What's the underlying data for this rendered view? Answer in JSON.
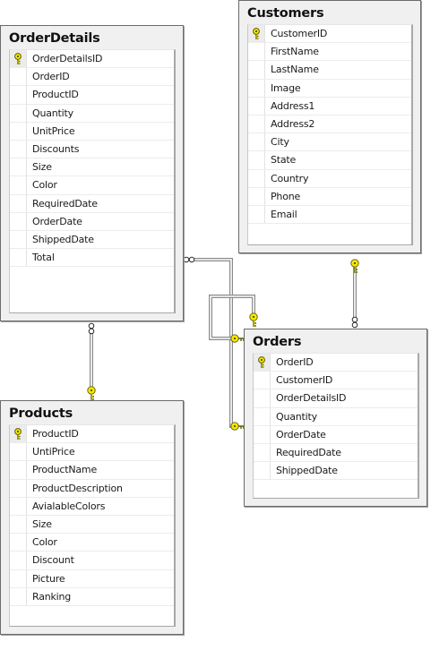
{
  "diagram": {
    "tables": [
      {
        "name": "OrderDetails",
        "columns": [
          {
            "name": "OrderDetailsID",
            "primary_key": true
          },
          {
            "name": "OrderID",
            "primary_key": false
          },
          {
            "name": "ProductID",
            "primary_key": false
          },
          {
            "name": "Quantity",
            "primary_key": false
          },
          {
            "name": "UnitPrice",
            "primary_key": false
          },
          {
            "name": "Discounts",
            "primary_key": false
          },
          {
            "name": "Size",
            "primary_key": false
          },
          {
            "name": "Color",
            "primary_key": false
          },
          {
            "name": "RequiredDate",
            "primary_key": false
          },
          {
            "name": "OrderDate",
            "primary_key": false
          },
          {
            "name": "ShippedDate",
            "primary_key": false
          },
          {
            "name": "Total",
            "primary_key": false
          }
        ]
      },
      {
        "name": "Customers",
        "columns": [
          {
            "name": "CustomerID",
            "primary_key": true
          },
          {
            "name": "FirstName",
            "primary_key": false
          },
          {
            "name": "LastName",
            "primary_key": false
          },
          {
            "name": "Image",
            "primary_key": false
          },
          {
            "name": "Address1",
            "primary_key": false
          },
          {
            "name": "Address2",
            "primary_key": false
          },
          {
            "name": "City",
            "primary_key": false
          },
          {
            "name": "State",
            "primary_key": false
          },
          {
            "name": "Country",
            "primary_key": false
          },
          {
            "name": "Phone",
            "primary_key": false
          },
          {
            "name": "Email",
            "primary_key": false
          }
        ]
      },
      {
        "name": "Orders",
        "columns": [
          {
            "name": "OrderID",
            "primary_key": true
          },
          {
            "name": "CustomerID",
            "primary_key": false
          },
          {
            "name": "OrderDetailsID",
            "primary_key": false
          },
          {
            "name": "Quantity",
            "primary_key": false
          },
          {
            "name": "OrderDate",
            "primary_key": false
          },
          {
            "name": "RequiredDate",
            "primary_key": false
          },
          {
            "name": "ShippedDate",
            "primary_key": false
          }
        ]
      },
      {
        "name": "Products",
        "columns": [
          {
            "name": "ProductID",
            "primary_key": true
          },
          {
            "name": "UntiPrice",
            "primary_key": false
          },
          {
            "name": "ProductName",
            "primary_key": false
          },
          {
            "name": "ProductDescription",
            "primary_key": false
          },
          {
            "name": "AvialableColors",
            "primary_key": false
          },
          {
            "name": "Size",
            "primary_key": false
          },
          {
            "name": "Color",
            "primary_key": false
          },
          {
            "name": "Discount",
            "primary_key": false
          },
          {
            "name": "Picture",
            "primary_key": false
          },
          {
            "name": "Ranking",
            "primary_key": false
          }
        ]
      }
    ],
    "relationships": [
      {
        "from": "Products",
        "from_end": "one",
        "to": "OrderDetails",
        "to_end": "many"
      },
      {
        "from": "Orders",
        "from_end": "one",
        "to": "OrderDetails",
        "to_end": "many"
      },
      {
        "from": "Customers",
        "from_end": "one",
        "to": "Orders",
        "to_end": "many"
      },
      {
        "from": "Orders",
        "from_end": "one",
        "to": "Orders",
        "to_end": "one",
        "self_reference": true
      }
    ],
    "colors": {
      "key_fill": "#f5e900",
      "key_stroke": "#6b6b00",
      "box_background": "#f0f0f0",
      "box_border": "#6b6b6b"
    }
  }
}
